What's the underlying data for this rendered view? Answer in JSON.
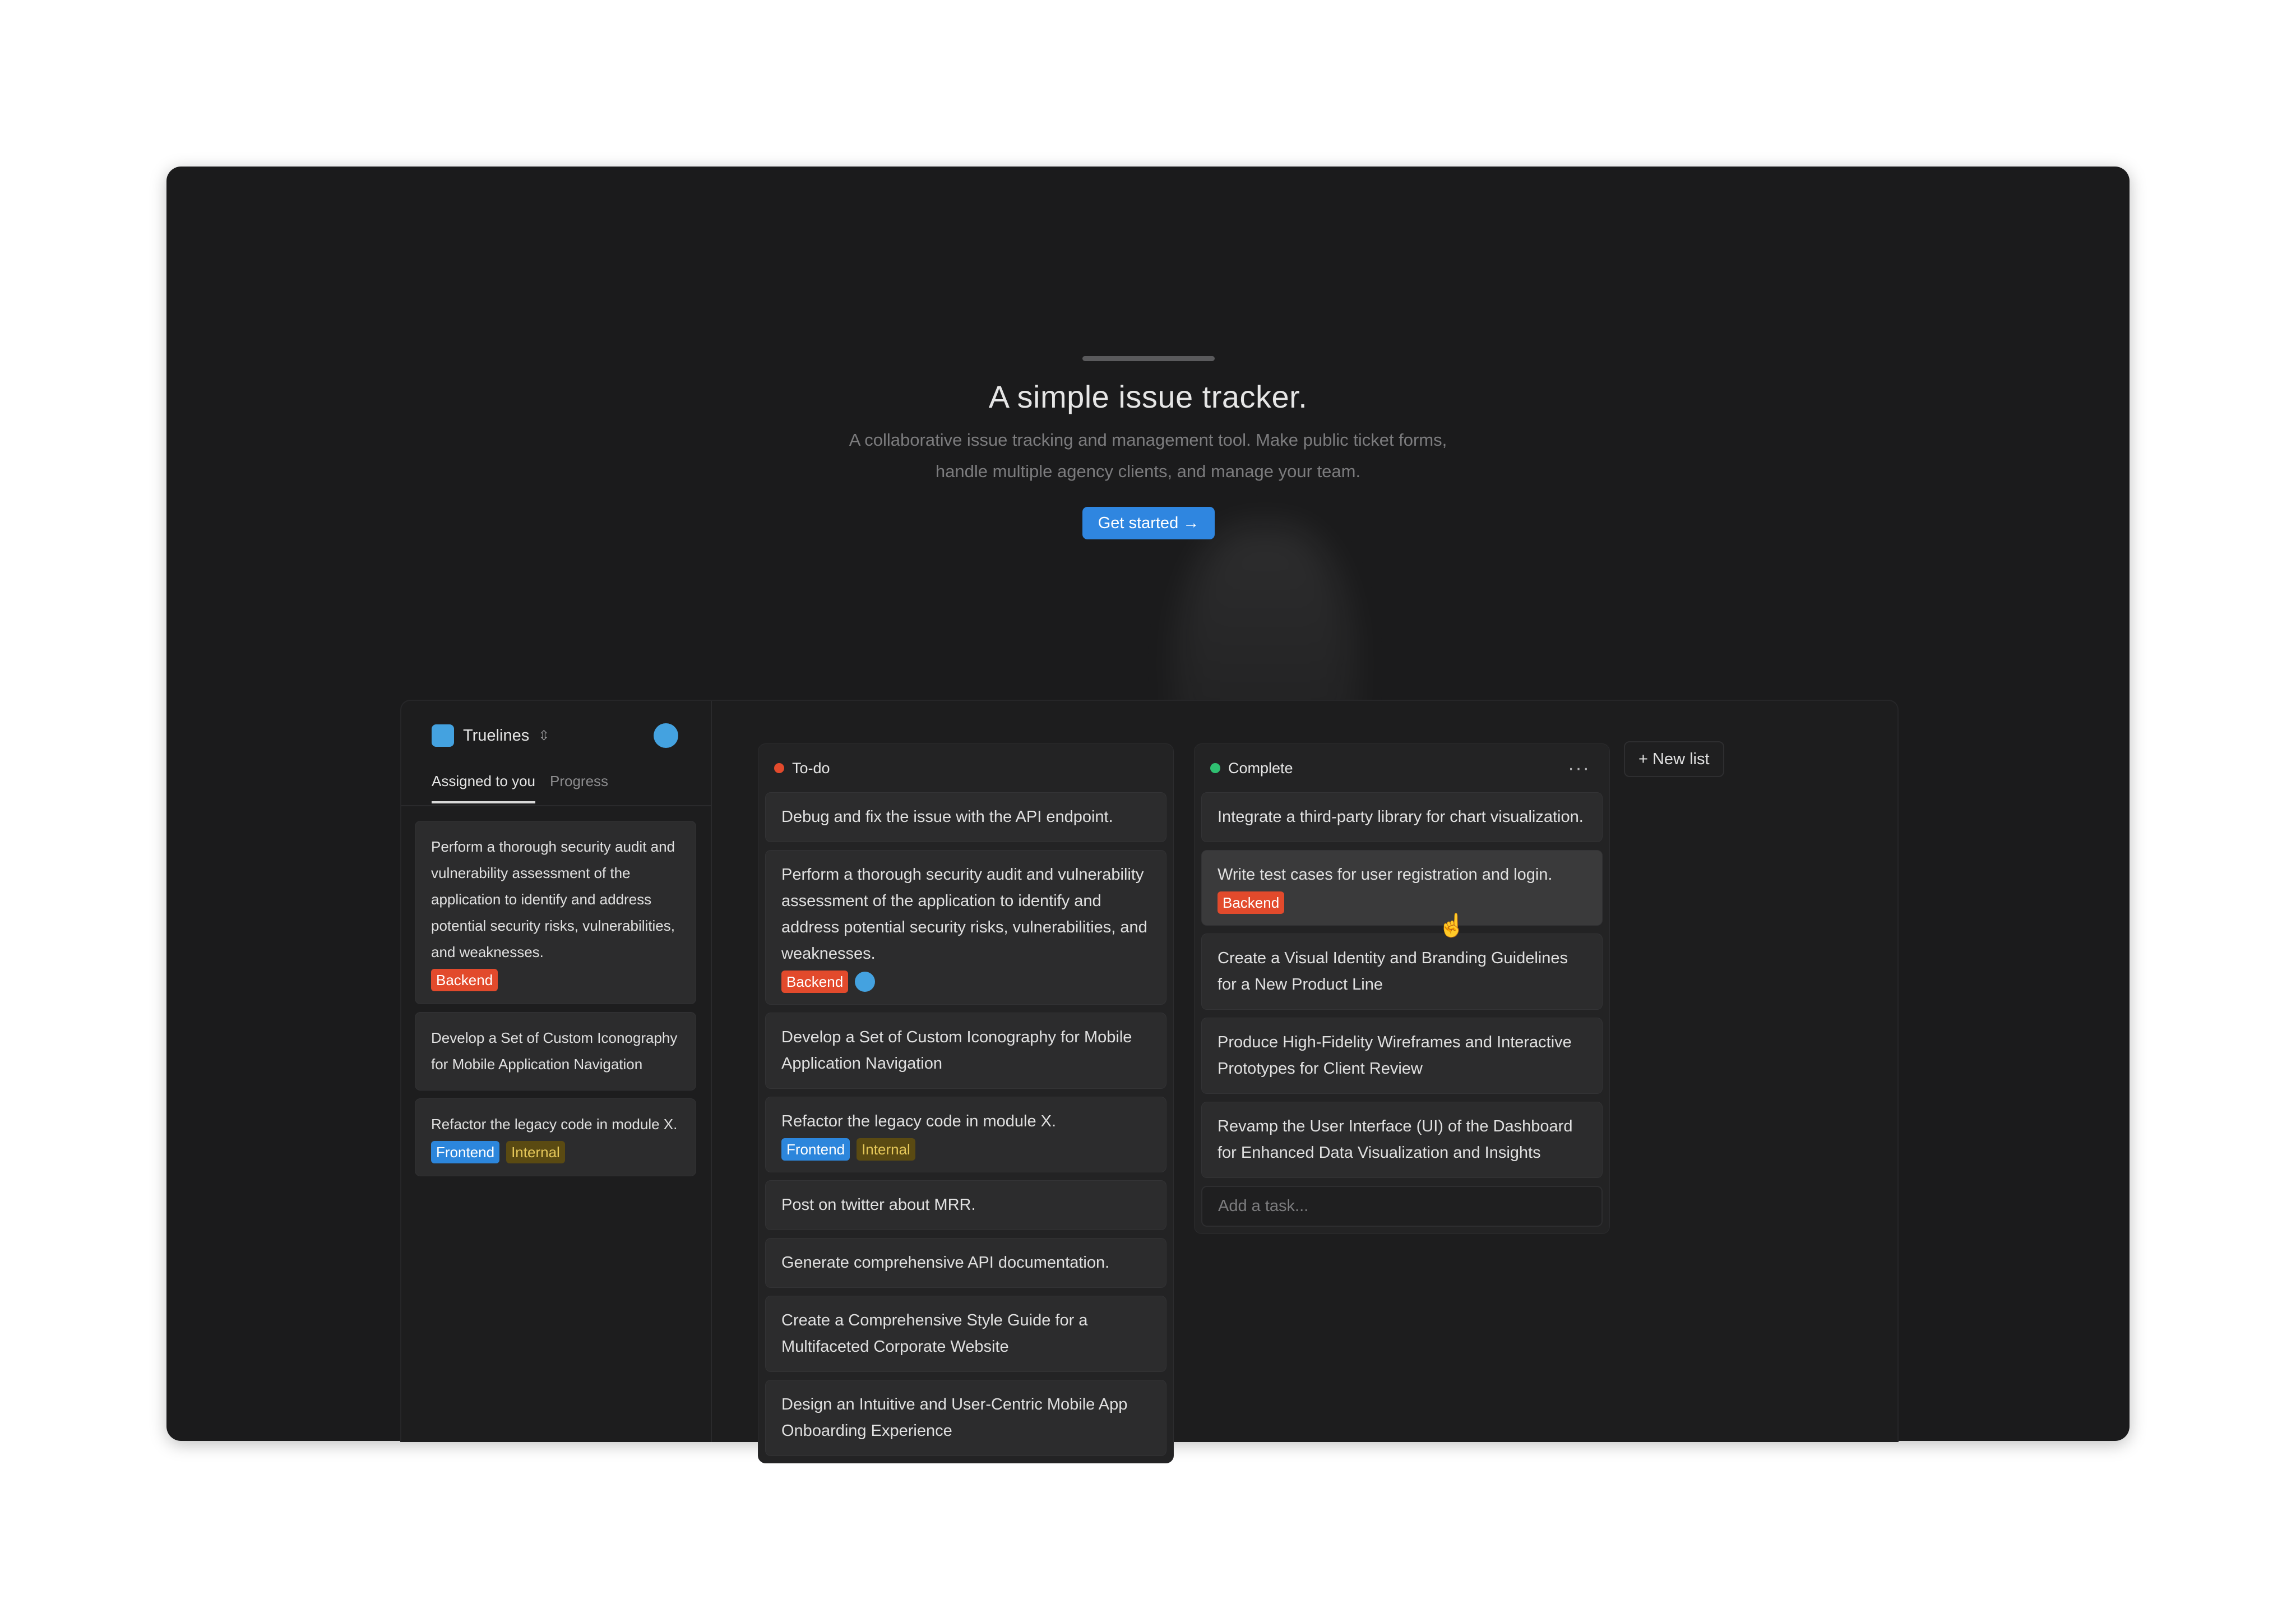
{
  "hero": {
    "title": "A simple issue tracker.",
    "subtitle_line1": "A collaborative issue tracking and management tool. Make public ticket forms,",
    "subtitle_line2": "handle multiple agency clients, and manage your team.",
    "cta_label": "Get started →"
  },
  "sidebar": {
    "workspace": "Truelines",
    "tabs": [
      "Assigned to you",
      "Progress"
    ],
    "cards": [
      {
        "text": "Perform a thorough security audit and vulnerability assessment of the application to identify and address potential security risks, vulnerabilities, and weaknesses.",
        "tags": [
          "Backend"
        ]
      },
      {
        "text": "Develop a Set of Custom Iconography for Mobile Application Navigation",
        "tags": []
      },
      {
        "text": "Refactor the legacy code in module X.",
        "tags": [
          "Frontend",
          "Internal"
        ]
      }
    ]
  },
  "todo": {
    "title": "To-do",
    "color": "#e24a2c",
    "cards": [
      {
        "text": "Debug and fix the issue with the API endpoint.",
        "tags": []
      },
      {
        "text": "Perform a thorough security audit and vulnerability assessment of the application to identify and address potential security risks, vulnerabilities, and weaknesses.",
        "tags": [
          "Backend"
        ]
      },
      {
        "text": "Develop a Set of Custom Iconography for Mobile Application Navigation",
        "tags": []
      },
      {
        "text": "Refactor the legacy code in module X.",
        "tags": [
          "Frontend",
          "Internal"
        ]
      },
      {
        "text": "Post on twitter about MRR.",
        "tags": []
      },
      {
        "text": "Generate comprehensive API documentation.",
        "tags": []
      },
      {
        "text": "Create a Comprehensive Style Guide for a Multifaceted Corporate Website",
        "tags": []
      },
      {
        "text": "Design an Intuitive and User-Centric Mobile App Onboarding Experience",
        "tags": []
      }
    ]
  },
  "complete": {
    "title": "Complete",
    "color": "#2fbf71",
    "cards": [
      {
        "text": "Integrate a third-party library for chart visualization.",
        "tags": []
      },
      {
        "text": "Write test cases for user registration and login.",
        "tags": [
          "Backend"
        ]
      },
      {
        "text": "Create a Visual Identity and Branding Guidelines for a New Product Line",
        "tags": []
      },
      {
        "text": "Produce High-Fidelity Wireframes and Interactive Prototypes for Client Review",
        "tags": []
      },
      {
        "text": "Revamp the User Interface (UI) of the Dashboard for Enhanced Data Visualization and Insights",
        "tags": []
      }
    ],
    "add_placeholder": "Add a task..."
  },
  "new_list_label": "+ New list",
  "icons": {
    "workspace": "workspace-icon",
    "chevron": "chevron-updown-icon",
    "avatar": "avatar",
    "more": "more-icon",
    "cursor": "pointer-cursor-icon"
  }
}
